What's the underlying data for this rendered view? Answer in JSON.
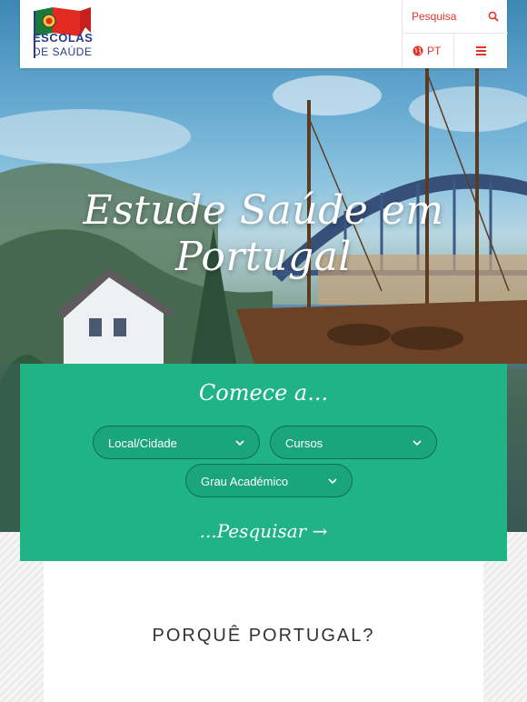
{
  "header": {
    "logo": {
      "line1": "ESCOLAS",
      "line2": "DE SAÚDE",
      "alt": "Escolas de Saúde logo"
    },
    "search_label": "Pesquisa",
    "language_label": "PT"
  },
  "hero": {
    "title": "Estude Saúde em Portugal"
  },
  "search_panel": {
    "title": "Comece a...",
    "local_select": {
      "value": "Local/Cidade"
    },
    "cursos_select": {
      "value": "Cursos"
    },
    "grau_select": {
      "value": "Grau Académico"
    },
    "search_link": "...Pesquisar →"
  },
  "sections": {
    "why_portugal_title": "PORQUÊ PORTUGAL?"
  },
  "colors": {
    "accent_red": "#e2342b",
    "panel_green": "#20b386",
    "logo_blue": "#2a3a8a"
  }
}
